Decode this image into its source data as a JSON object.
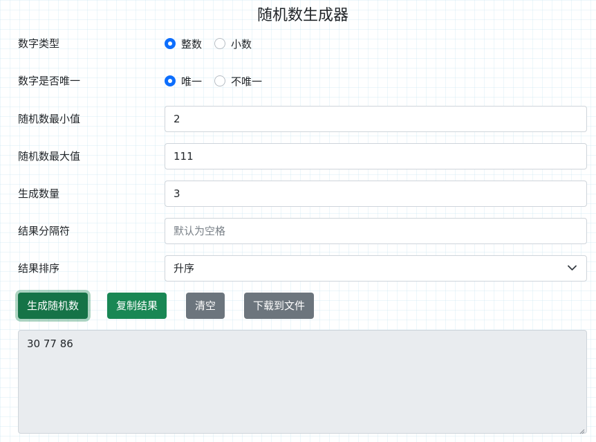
{
  "title": "随机数生成器",
  "number_type": {
    "label": "数字类型",
    "options": [
      "整数",
      "小数"
    ],
    "selected": "整数"
  },
  "unique": {
    "label": "数字是否唯一",
    "options": [
      "唯一",
      "不唯一"
    ],
    "selected": "唯一"
  },
  "min": {
    "label": "随机数最小值",
    "value": "2"
  },
  "max": {
    "label": "随机数最大值",
    "value": "111"
  },
  "count": {
    "label": "生成数量",
    "value": "3"
  },
  "separator": {
    "label": "结果分隔符",
    "value": "",
    "placeholder": "默认为空格"
  },
  "sort": {
    "label": "结果排序",
    "selected": "升序"
  },
  "buttons": {
    "generate": "生成随机数",
    "copy": "复制结果",
    "clear": "清空",
    "download": "下载到文件"
  },
  "result": "30 77 86",
  "colors": {
    "accent": "#0d6efd",
    "generate_button": "#157347",
    "copy_button": "#198754",
    "secondary_button": "#6c757d",
    "result_bg": "#e9ecef"
  },
  "icons": {
    "select_chevron": "chevron-down-icon",
    "resize_grip": "resize-grip-icon"
  }
}
